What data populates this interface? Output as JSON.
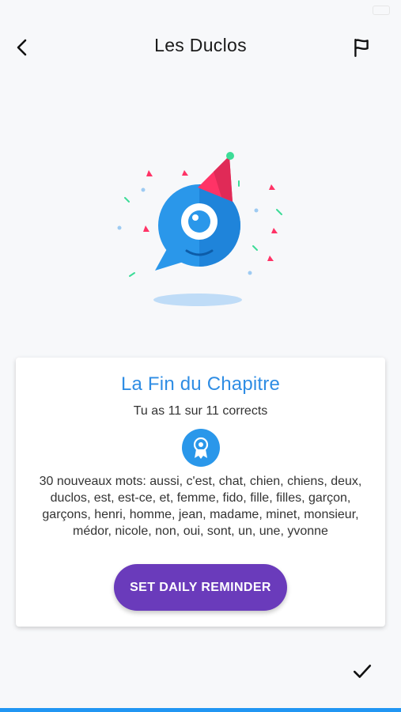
{
  "header": {
    "title": "Les Duclos",
    "back_icon": "chevron-left-icon",
    "flag_icon": "flag-icon"
  },
  "illustration": {
    "name": "party-chat-bubble-mascot"
  },
  "result_card": {
    "title": "La Fin du Chapitre",
    "score_text": "Tu as 11 sur 11 corrects",
    "badge_icon": "award-ribbon-icon",
    "words_text": "30 nouveaux mots: aussi, c'est, chat, chien, chiens, deux, duclos, est, est-ce, et, femme, fido, fille, filles, garçon, garçons, henri, homme, jean, madame, minet, monsieur, médor, nicole, non, oui, sont, un, une, yvonne",
    "reminder_button": "SET DAILY REMINDER"
  },
  "footer": {
    "done_icon": "checkmark-icon"
  },
  "colors": {
    "accent_blue": "#2f8de4",
    "button_purple": "#6a3bbb",
    "bottom_bar": "#2196f3",
    "party_hat_pink": "#ff3366"
  }
}
